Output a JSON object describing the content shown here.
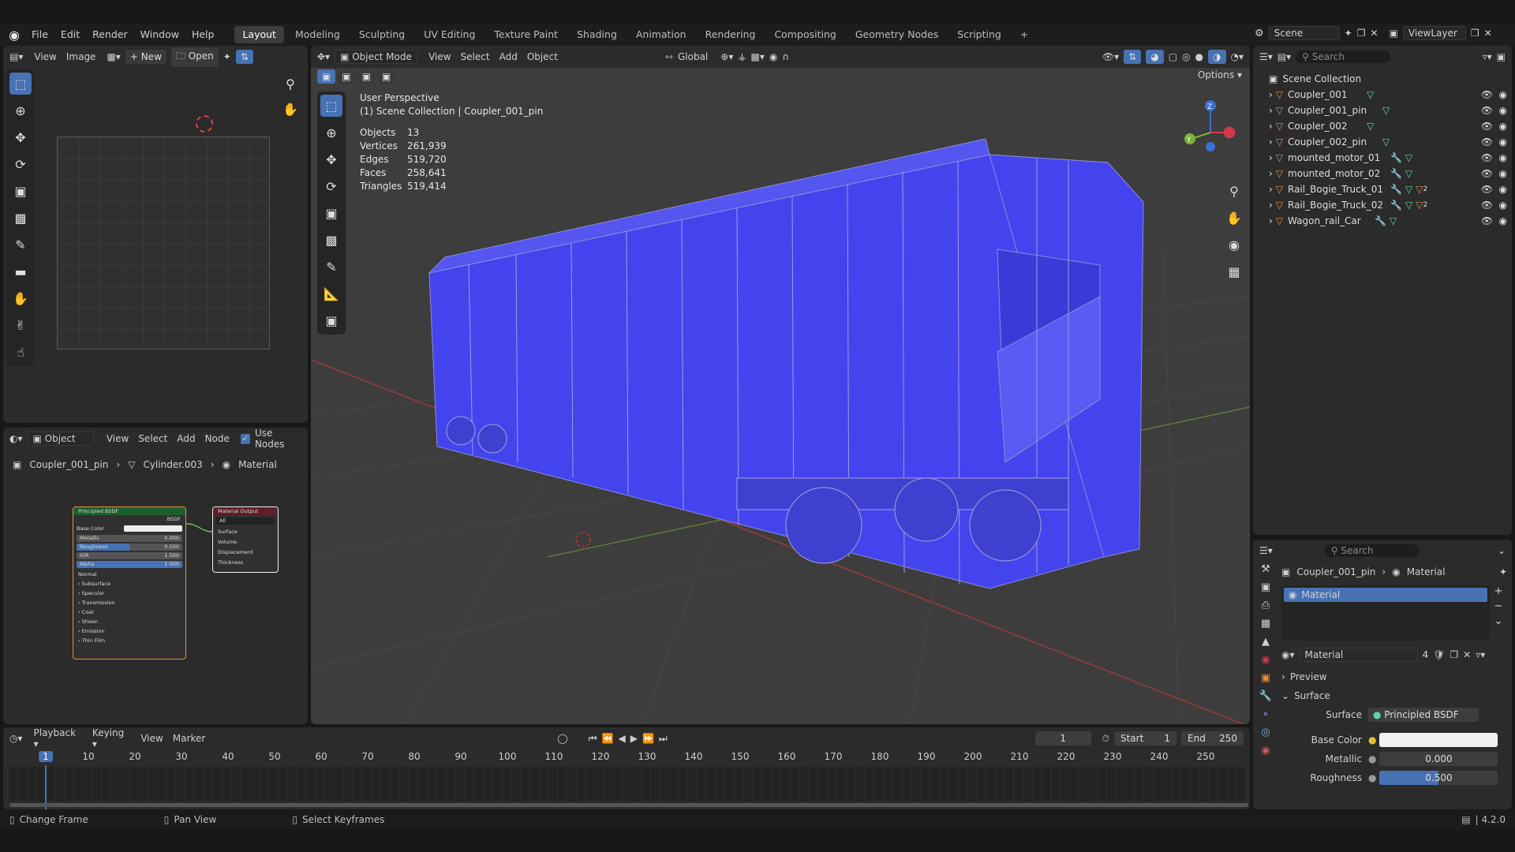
{
  "topbar": {
    "menus": [
      "File",
      "Edit",
      "Render",
      "Window",
      "Help"
    ],
    "tabs": [
      "Layout",
      "Modeling",
      "Sculpting",
      "UV Editing",
      "Texture Paint",
      "Shading",
      "Animation",
      "Rendering",
      "Compositing",
      "Geometry Nodes",
      "Scripting"
    ],
    "active_tab": "Layout",
    "scene": "Scene",
    "viewlayer": "ViewLayer"
  },
  "image_editor": {
    "menus": [
      "View",
      "Image"
    ],
    "new": "New",
    "open": "Open"
  },
  "viewport": {
    "mode": "Object Mode",
    "menus": [
      "View",
      "Select",
      "Add",
      "Object"
    ],
    "orientation": "Global",
    "options": "Options",
    "perspective": "User Perspective",
    "context": "(1) Scene Collection | Coupler_001_pin",
    "stats": [
      {
        "label": "Objects",
        "value": "13"
      },
      {
        "label": "Vertices",
        "value": "261,939"
      },
      {
        "label": "Edges",
        "value": "519,720"
      },
      {
        "label": "Faces",
        "value": "258,641"
      },
      {
        "label": "Triangles",
        "value": "519,414"
      }
    ]
  },
  "node_editor": {
    "type": "Object",
    "menus": [
      "View",
      "Select",
      "Add",
      "Node"
    ],
    "use_nodes": "Use Nodes",
    "breadcrumb": [
      "Coupler_001_pin",
      "Cylinder.003",
      "Material"
    ],
    "bsdf": {
      "title": "Principled BSDF",
      "out": "BSDF",
      "rows": [
        {
          "label": "Base Color",
          "value": ""
        },
        {
          "label": "Metallic",
          "value": "0.000"
        },
        {
          "label": "Roughness",
          "value": "0.500"
        },
        {
          "label": "IOR",
          "value": "1.500"
        },
        {
          "label": "Alpha",
          "value": "1.000"
        }
      ],
      "normal": "Normal",
      "sections": [
        "Subsurface",
        "Specular",
        "Transmission",
        "Coat",
        "Sheen",
        "Emission",
        "Thin Film"
      ]
    },
    "output": {
      "title": "Material Output",
      "target": "All",
      "inputs": [
        "Surface",
        "Volume",
        "Displacement",
        "Thickness"
      ]
    }
  },
  "outliner": {
    "search": "Search",
    "root": "Scene Collection",
    "items": [
      "Coupler_001",
      "Coupler_001_pin",
      "Coupler_002",
      "Coupler_002_pin",
      "mounted_motor_01",
      "mounted_motor_02",
      "Rail_Bogie_Truck_01",
      "Rail_Bogie_Truck_02",
      "Wagon_rail_Car"
    ],
    "badge_count": "2"
  },
  "properties": {
    "search": "Search",
    "breadcrumb": [
      "Coupler_001_pin",
      "Material"
    ],
    "slot": "Material",
    "material_name": "Material",
    "users": "4",
    "preview": "Preview",
    "surface_section": "Surface",
    "surface_label": "Surface",
    "surface_value": "Principled BSDF",
    "base_color_label": "Base Color",
    "metallic_label": "Metallic",
    "metallic_value": "0.000",
    "roughness_label": "Roughness",
    "roughness_value": "0.500"
  },
  "timeline": {
    "menus": [
      "Playback",
      "Keying",
      "View",
      "Marker"
    ],
    "current": "1",
    "start_label": "Start",
    "start": "1",
    "end_label": "End",
    "end": "250",
    "ticks": [
      "1",
      "10",
      "20",
      "30",
      "40",
      "50",
      "60",
      "70",
      "80",
      "90",
      "100",
      "110",
      "120",
      "130",
      "140",
      "150",
      "160",
      "170",
      "180",
      "190",
      "200",
      "210",
      "220",
      "230",
      "240",
      "250"
    ]
  },
  "status": {
    "change_frame": "Change Frame",
    "pan_view": "Pan View",
    "select_keyframes": "Select Keyframes",
    "version": "4.2.0"
  }
}
